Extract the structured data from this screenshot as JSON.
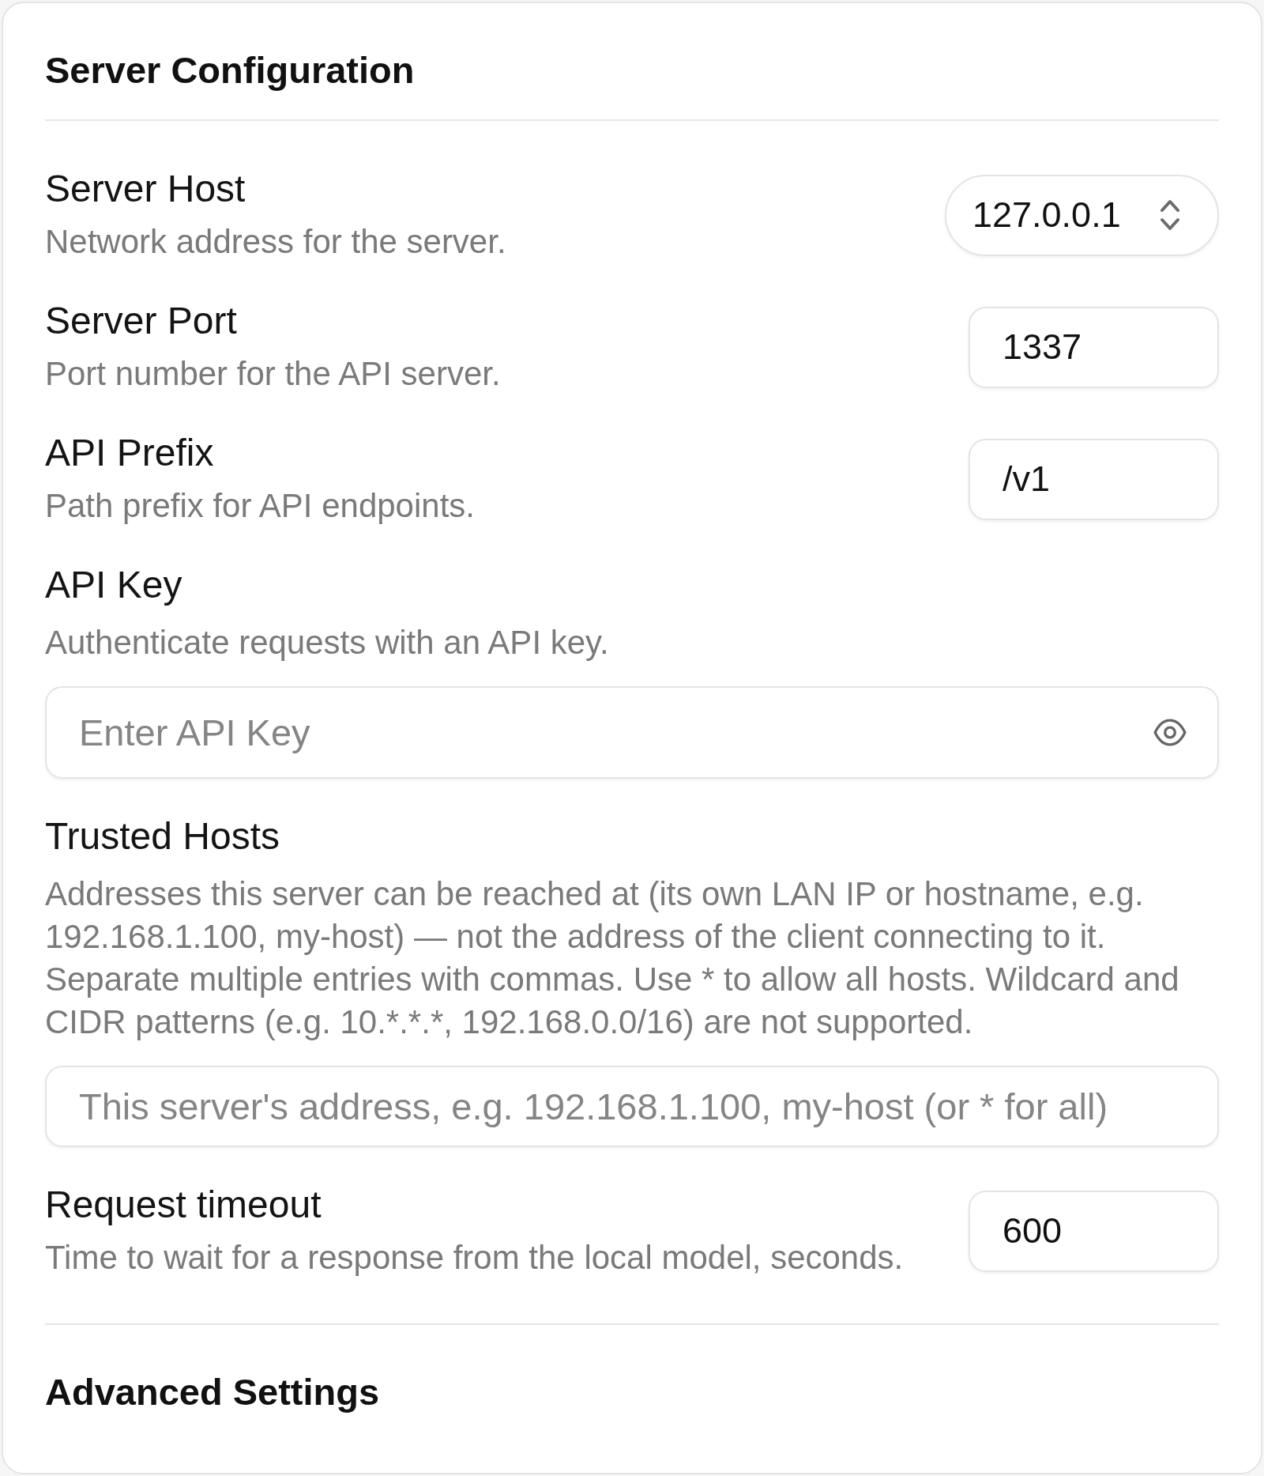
{
  "section": {
    "title": "Server Configuration"
  },
  "settings": [
    {
      "kind": "select",
      "label": "Server Host",
      "description": "Network address for the server.",
      "value": "127.0.0.1"
    },
    {
      "kind": "text",
      "label": "Server Port",
      "description": "Port number for the API server.",
      "value": "1337"
    },
    {
      "kind": "text",
      "label": "API Prefix",
      "description": "Path prefix for API endpoints.",
      "value": "/v1"
    },
    {
      "kind": "secret",
      "label": "API Key",
      "description": "Authenticate requests with an API key.",
      "placeholder": "Enter API Key"
    },
    {
      "kind": "wide_text",
      "label": "Trusted Hosts",
      "description": "Addresses this server can be reached at (its own LAN IP or hostname, e.g. 192.168.1.100, my-host) — not the address of the client connecting to it. Separate multiple entries with commas. Use * to allow all hosts. Wildcard and CIDR patterns (e.g. 10.*.*.*, 192.168.0.0/16) are not supported.",
      "placeholder": "This server's address, e.g. 192.168.1.100, my-host (or * for all)"
    },
    {
      "kind": "text",
      "label": "Request timeout",
      "description": "Time to wait for a response from the local model, seconds.",
      "value": "600"
    }
  ],
  "next_section": {
    "title": "Advanced Settings"
  }
}
